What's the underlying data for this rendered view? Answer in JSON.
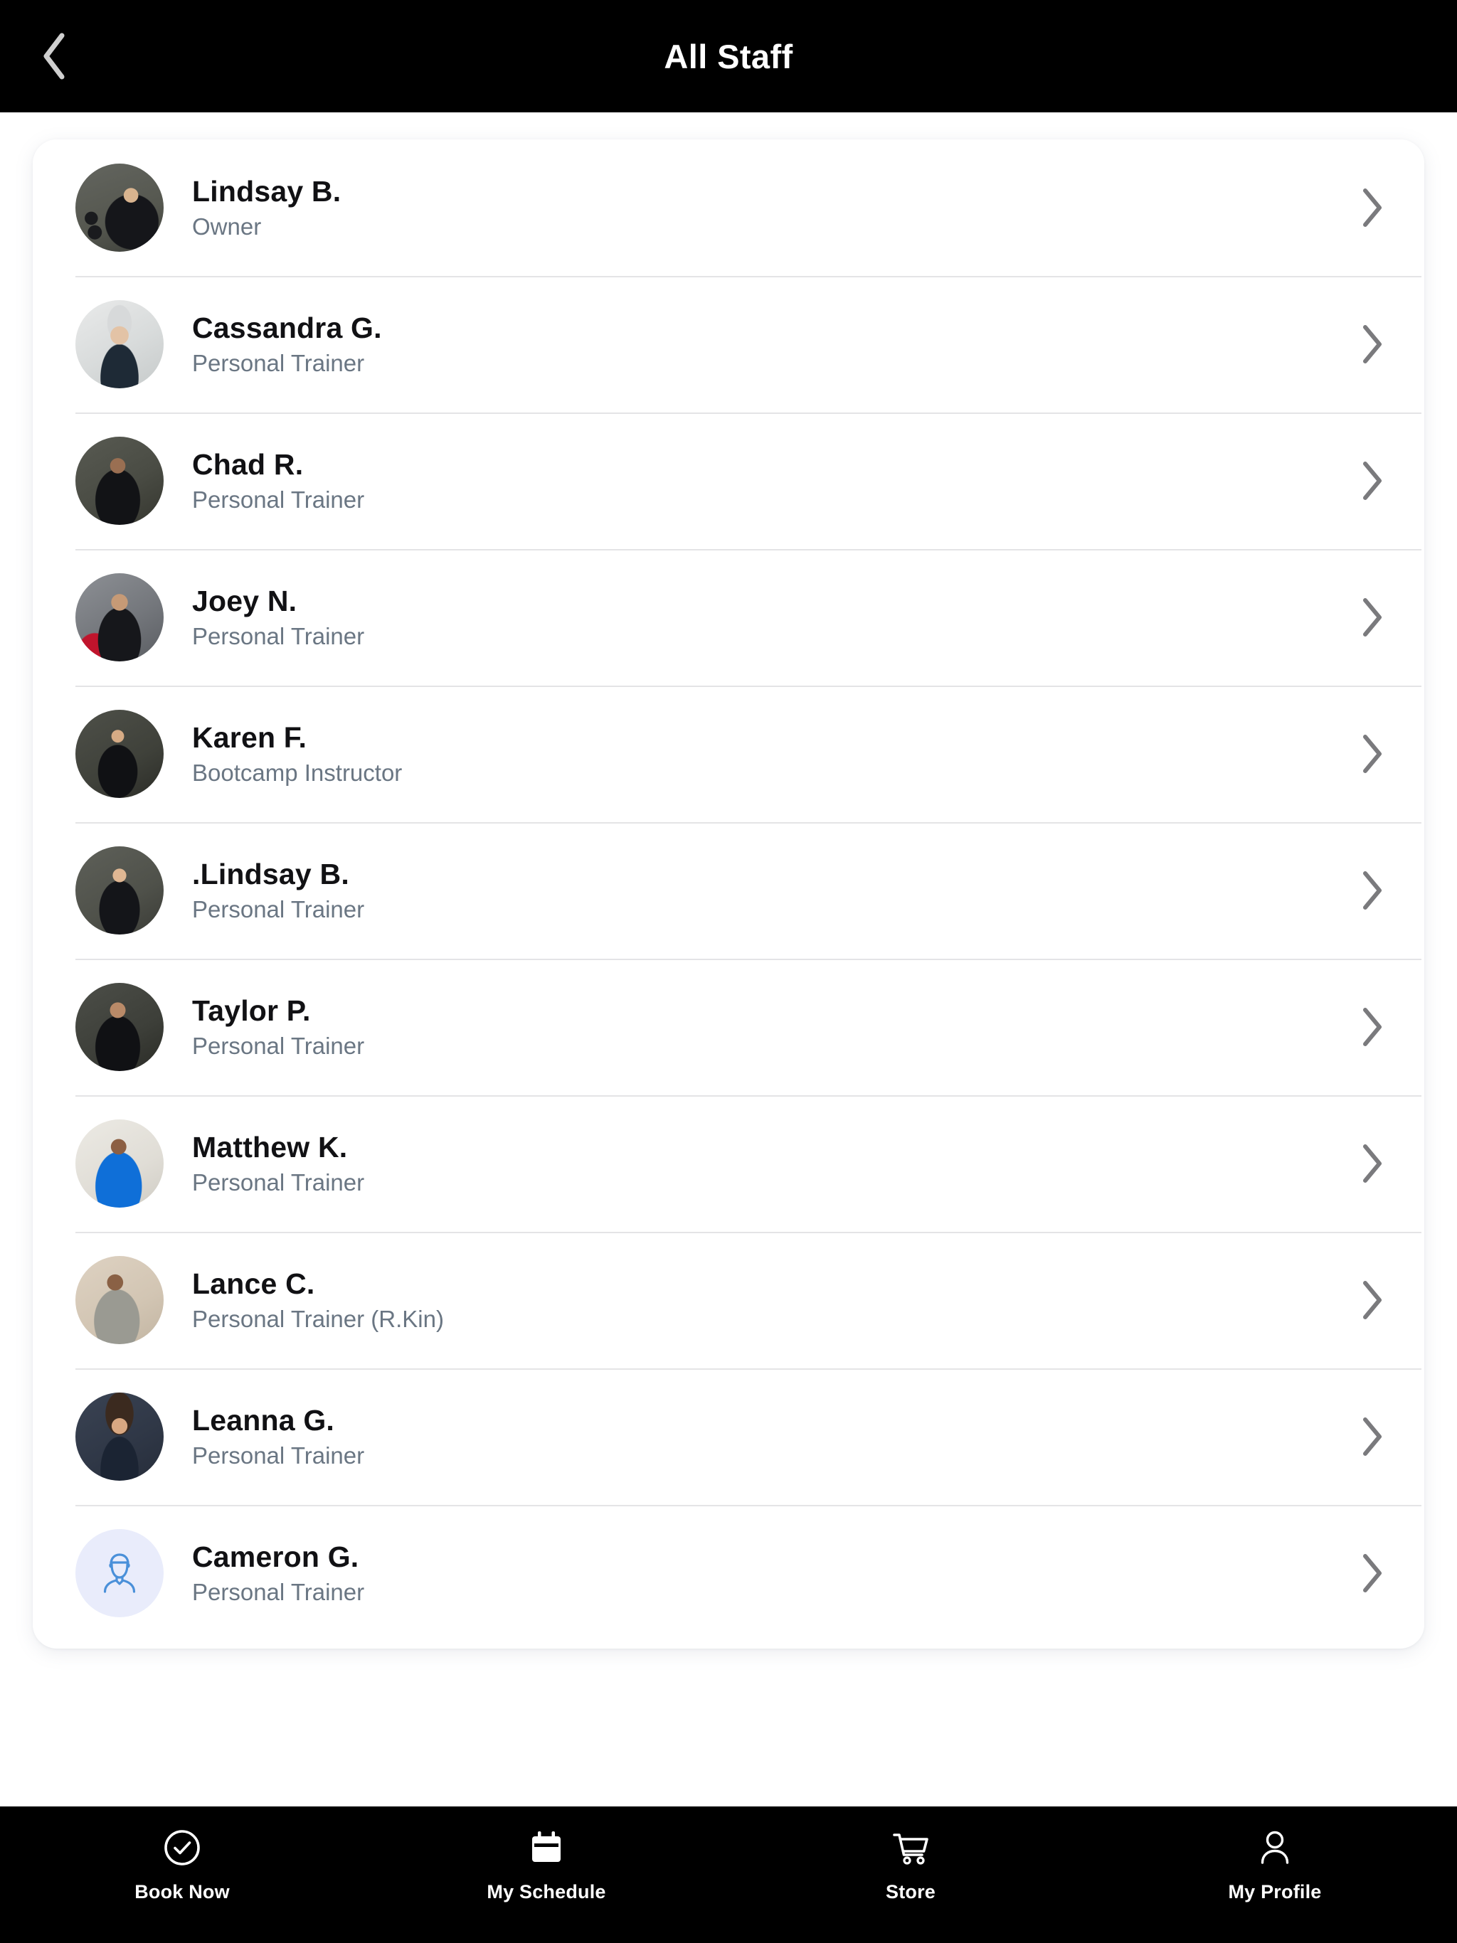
{
  "header": {
    "title": "All Staff",
    "back_icon": "chevron-left-icon"
  },
  "colors": {
    "header_bg": "#000000",
    "page_bg": "#ffffff",
    "card_bg": "#ffffff",
    "name_text": "#111114",
    "role_text": "#6a7683",
    "divider": "#e4e4e6",
    "chevron": "#7a7a7d",
    "placeholder_circle": "#e9ecfb",
    "placeholder_glyph": "#4a90d9",
    "tabbar_bg": "#000000",
    "tab_label": "#ffffff"
  },
  "staff": [
    {
      "name": "Lindsay B.",
      "role": "Owner",
      "avatar": "photo",
      "avatar_class": "av-lindsay",
      "chevron": "chevron-right-icon"
    },
    {
      "name": "Cassandra G.",
      "role": "Personal Trainer",
      "avatar": "photo",
      "avatar_class": "av-cassandra",
      "chevron": "chevron-right-icon"
    },
    {
      "name": "Chad R.",
      "role": "Personal Trainer",
      "avatar": "photo",
      "avatar_class": "av-chad",
      "chevron": "chevron-right-icon"
    },
    {
      "name": "Joey N.",
      "role": "Personal Trainer",
      "avatar": "photo",
      "avatar_class": "av-joey",
      "chevron": "chevron-right-icon"
    },
    {
      "name": "Karen F.",
      "role": "Bootcamp Instructor",
      "avatar": "photo",
      "avatar_class": "av-karen",
      "chevron": "chevron-right-icon"
    },
    {
      "name": ".Lindsay B.",
      "role": "Personal Trainer",
      "avatar": "photo",
      "avatar_class": "av-lindsay2",
      "chevron": "chevron-right-icon"
    },
    {
      "name": "Taylor P.",
      "role": "Personal Trainer",
      "avatar": "photo",
      "avatar_class": "av-taylor",
      "chevron": "chevron-right-icon"
    },
    {
      "name": "Matthew K.",
      "role": "Personal Trainer",
      "avatar": "photo",
      "avatar_class": "av-matthew",
      "chevron": "chevron-right-icon"
    },
    {
      "name": "Lance C.",
      "role": "Personal Trainer (R.Kin)",
      "avatar": "photo",
      "avatar_class": "av-lance",
      "chevron": "chevron-right-icon"
    },
    {
      "name": "Leanna G.",
      "role": "Personal Trainer",
      "avatar": "photo",
      "avatar_class": "av-leanna",
      "chevron": "chevron-right-icon"
    },
    {
      "name": "Cameron G.",
      "role": "Personal Trainer",
      "avatar": "placeholder",
      "avatar_class": "av-placeholder",
      "chevron": "chevron-right-icon"
    }
  ],
  "tabbar": {
    "items": [
      {
        "label": "Book Now",
        "icon": "check-circle-icon"
      },
      {
        "label": "My Schedule",
        "icon": "calendar-icon"
      },
      {
        "label": "Store",
        "icon": "shopping-cart-icon"
      },
      {
        "label": "My Profile",
        "icon": "person-icon"
      }
    ]
  }
}
